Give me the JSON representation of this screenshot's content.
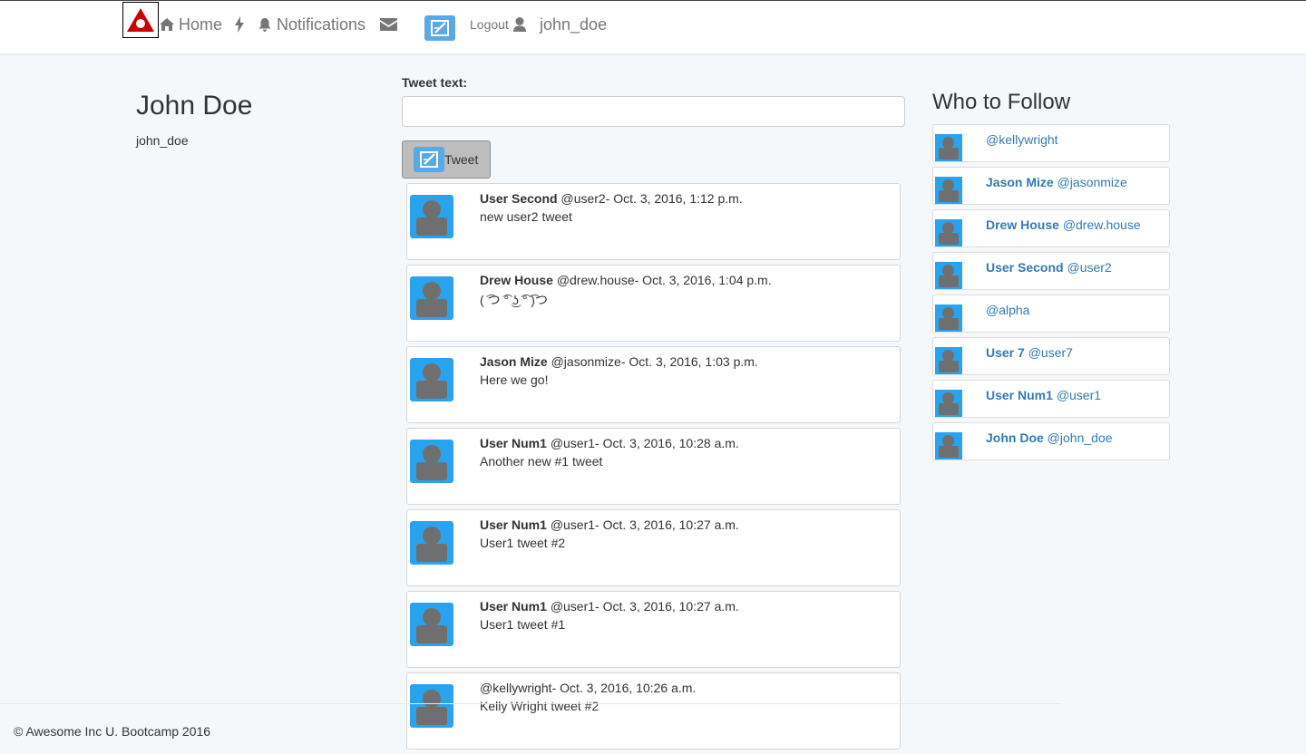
{
  "colors": {
    "accent": "#5aa9e6",
    "avatar_bg": "#2aa3ef",
    "link": "#337ab7",
    "logo_red": "#cc0000"
  },
  "nav": {
    "logo_icon": "triangle-logo-icon",
    "home_label": "Home",
    "notifications_label": "Notifications",
    "logout_label": "Logout",
    "username": "john_doe"
  },
  "profile": {
    "name": "John Doe",
    "handle": "john_doe"
  },
  "compose": {
    "label": "Tweet text:",
    "value": "",
    "placeholder": "",
    "button_label": "Tweet"
  },
  "feed": [
    {
      "name": "User Second",
      "meta": "@user2- Oct. 3, 2016, 1:12 p.m.",
      "text": "new user2 tweet"
    },
    {
      "name": "Drew House",
      "meta": "@drew.house- Oct. 3, 2016, 1:04 p.m.",
      "text": "( ͡つ ͡° ͜ʖ ͡° ͡)つ"
    },
    {
      "name": "Jason Mize",
      "meta": "@jasonmize- Oct. 3, 2016, 1:03 p.m.",
      "text": "Here we go!"
    },
    {
      "name": "User Num1",
      "meta": "@user1- Oct. 3, 2016, 10:28 a.m.",
      "text": "Another new #1 tweet"
    },
    {
      "name": "User Num1",
      "meta": "@user1- Oct. 3, 2016, 10:27 a.m.",
      "text": "User1 tweet #2"
    },
    {
      "name": "User Num1",
      "meta": "@user1- Oct. 3, 2016, 10:27 a.m.",
      "text": "User1 tweet #1"
    },
    {
      "name": "",
      "meta": "@kellywright- Oct. 3, 2016, 10:26 a.m.",
      "text": "Kelly Wright tweet #2"
    }
  ],
  "who_to_follow": {
    "title": "Who to Follow",
    "users": [
      {
        "name": "",
        "handle": "@kellywright"
      },
      {
        "name": "Jason Mize",
        "handle": "@jasonmize"
      },
      {
        "name": "Drew House",
        "handle": "@drew.house"
      },
      {
        "name": "User Second",
        "handle": "@user2"
      },
      {
        "name": "",
        "handle": "@alpha"
      },
      {
        "name": "User 7",
        "handle": "@user7"
      },
      {
        "name": "User Num1",
        "handle": "@user1"
      },
      {
        "name": "John Doe",
        "handle": "@john_doe"
      }
    ]
  },
  "footer": {
    "text": "© Awesome Inc U. Bootcamp 2016"
  }
}
